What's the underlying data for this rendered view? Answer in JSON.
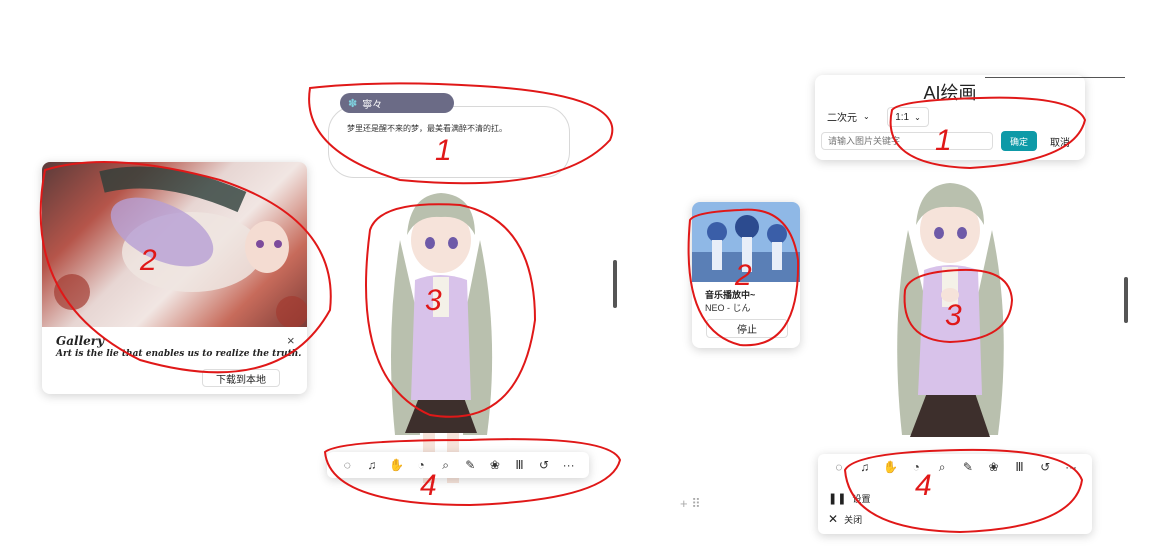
{
  "left": {
    "chat": {
      "name": "寧々",
      "message": "梦里还是醒不来的梦，最美看满醉不清的扛。"
    },
    "gallery": {
      "title": "Gallery",
      "quote": "Art is the lie that enables us to realize the truth.",
      "download_label": "下载到本地",
      "close_icon": "×"
    },
    "toolbar": {
      "icons": [
        "chat-icon",
        "music-icon",
        "hand-icon",
        "palette-icon",
        "search-icon",
        "pen-icon",
        "paint-icon",
        "library-icon",
        "history-icon",
        "more-icon"
      ],
      "glyphs": [
        "◌",
        "♫",
        "✋",
        "◔",
        "⌕",
        "✎",
        "❀",
        "Ⅲ",
        "↺",
        "···"
      ]
    },
    "annotations": [
      "1",
      "2",
      "3",
      "4"
    ]
  },
  "right": {
    "ai_panel": {
      "title": "AI绘画",
      "style_select": "二次元",
      "ratio_select": "1:1",
      "keyword_placeholder": "请输入图片关键字",
      "confirm_label": "确定",
      "cancel_label": "取消"
    },
    "music": {
      "status": "音乐播放中~",
      "track": "NEO - じん",
      "stop_label": "停止"
    },
    "toolbar": {
      "glyphs": [
        "◌",
        "♫",
        "✋",
        "◔",
        "⌕",
        "✎",
        "❀",
        "Ⅲ",
        "↺",
        "···"
      ]
    },
    "menu": {
      "settings_label": "设置",
      "close_label": "关闭"
    },
    "annotations": [
      "1",
      "2",
      "3",
      "4"
    ]
  },
  "colors": {
    "accent_teal": "#0e9aa7",
    "chat_header": "#6b6b86",
    "annotation_red": "#e01818",
    "hair": "#b9c0ae",
    "cardigan": "#d8c2ea",
    "skirt": "#3d2f2c"
  }
}
